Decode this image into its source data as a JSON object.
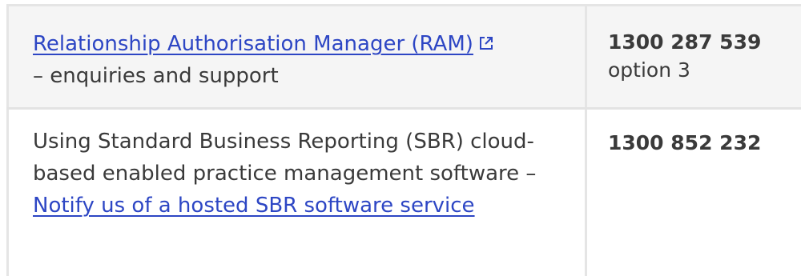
{
  "rows": [
    {
      "link_text": "Relationship Authorisation Manager (RAM)",
      "description": "– enquiries and support",
      "phone": "1300 287 539",
      "phone_option": "option 3",
      "icons": {
        "external_link": "external-link-icon"
      }
    },
    {
      "description_before": "Using Standard Business Reporting (SBR) cloud-based enabled practice management software – ",
      "link_text": "Notify us of a hosted SBR software service",
      "phone": "1300 852 232"
    }
  ],
  "colors": {
    "link": "#2d46c4",
    "text": "#3a3a3a",
    "row_shaded": "#f5f5f5",
    "border": "#e5e5e5"
  }
}
